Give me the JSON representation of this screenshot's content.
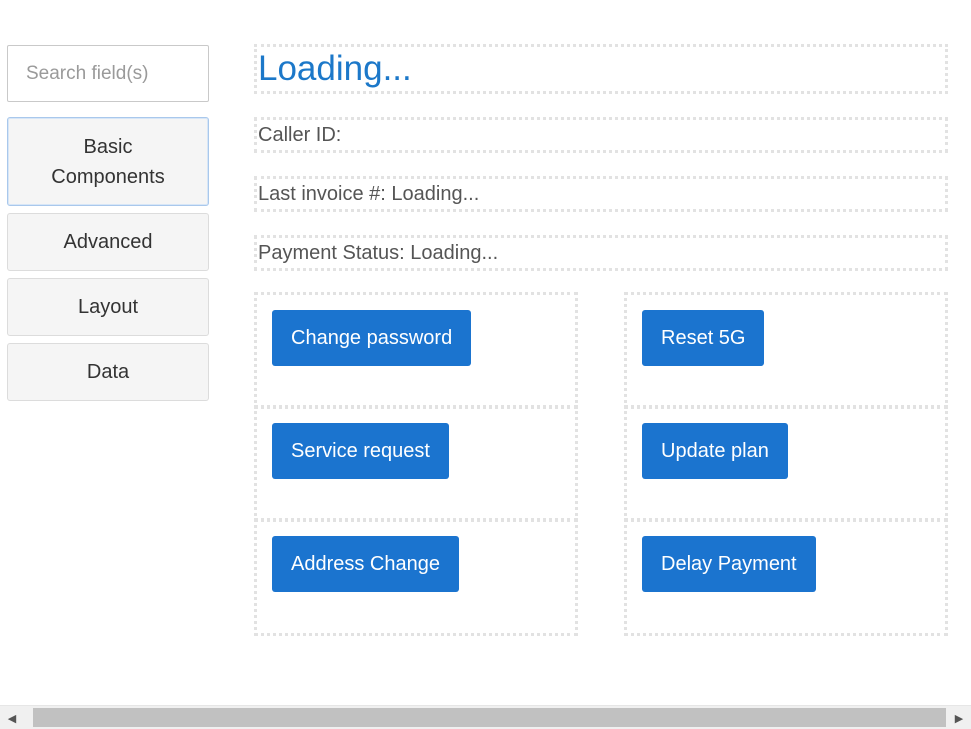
{
  "sidebar": {
    "search": {
      "placeholder": "Search field(s)",
      "value": ""
    },
    "items": [
      {
        "label": "Basic\nComponents",
        "active": true
      },
      {
        "label": "Advanced",
        "active": false
      },
      {
        "label": "Layout",
        "active": false
      },
      {
        "label": "Data",
        "active": false
      }
    ]
  },
  "main": {
    "title": "Loading...",
    "caller_id": "Caller ID:",
    "last_invoice": "Last invoice #: Loading...",
    "payment_status": "Payment Status: Loading...",
    "actions": [
      "Change password",
      "Reset 5G",
      "Service request",
      "Update plan",
      "Address Change",
      "Delay Payment"
    ]
  },
  "scrollbar": {
    "left_arrow": "◀",
    "right_arrow": "▶"
  },
  "colors": {
    "accent": "#1b74cf",
    "title": "#1c78c9",
    "border_dotted": "#e2e2e2"
  }
}
